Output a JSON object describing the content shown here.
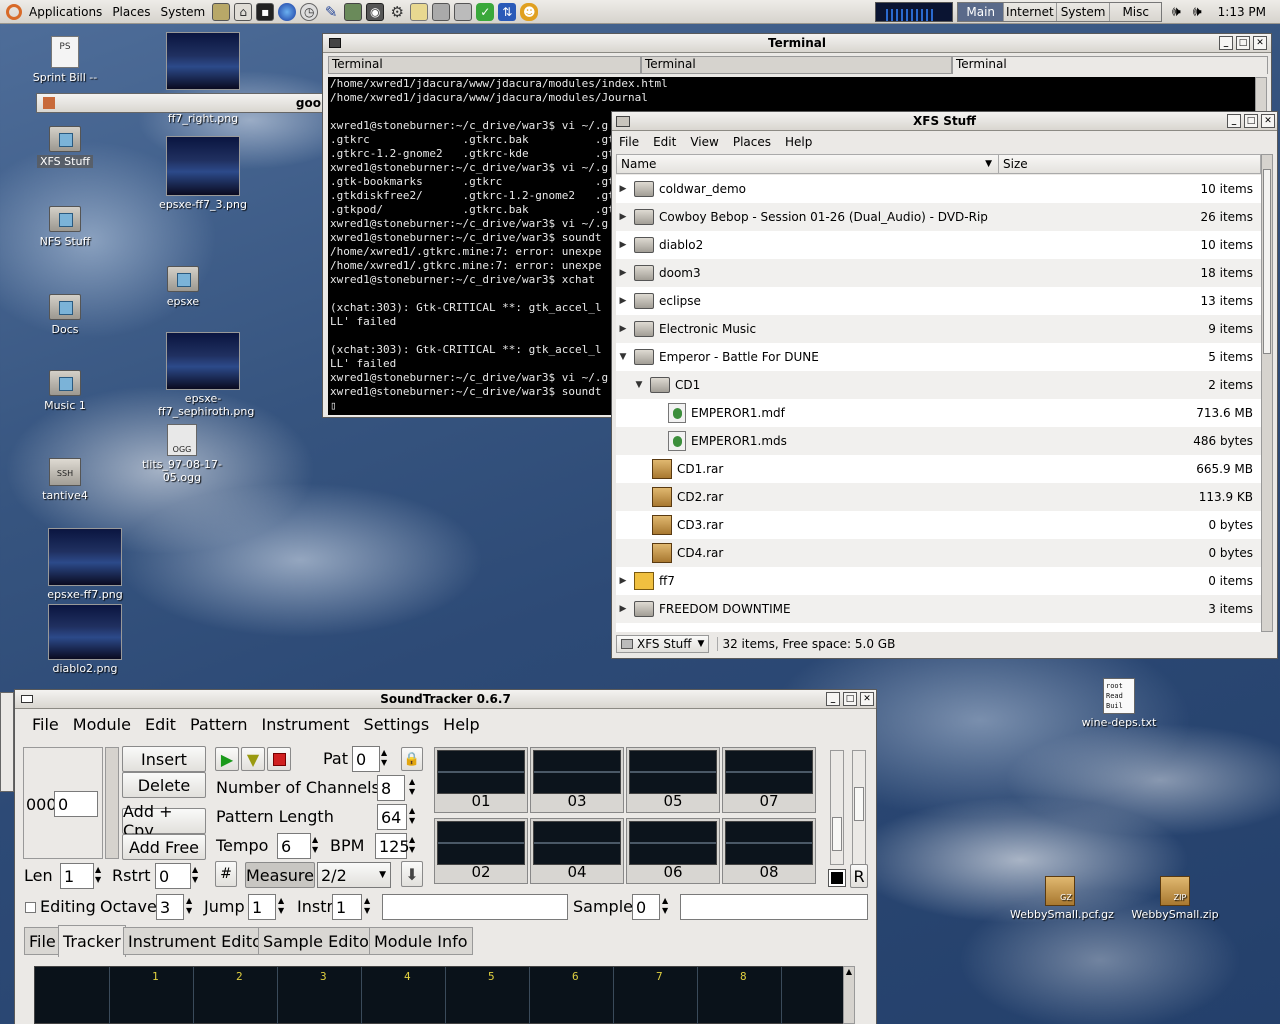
{
  "panel": {
    "menus": [
      "Applications",
      "Places",
      "System"
    ],
    "workspaces": [
      "Main",
      "Internet",
      "System",
      "Misc"
    ],
    "clock": "1:13 PM"
  },
  "desktop": {
    "icons": [
      "Sprint Bill -- Fucked up ?",
      "XFS Stuff",
      "NFS Stuff",
      "Docs",
      "Music 1",
      "tantive4",
      "ff7_right.png",
      "epsxe-ff7_3.png",
      "epsxe",
      "epsxe-ff7_sephiroth.png",
      "tlits_97-08-17-05.ogg",
      "epsxe-ff7.png",
      "diablo2.png",
      "wine-deps.txt",
      "WebbySmall.pcf.gz",
      "WebbySmall.zip"
    ],
    "readme_text": "root\nRead\nBuil",
    "partial_window_title": "goo",
    "ps_badge": "PS",
    "ogg_badge": "OGG",
    "ssh_badge": "SSH",
    "gz_badge": "GZ",
    "zip_badge": "ZIP"
  },
  "terminal": {
    "title": "Terminal",
    "tabs": [
      "Terminal",
      "Terminal",
      "Terminal"
    ],
    "lines": "/home/xwred1/jdacura/www/jdacura/modules/index.html\n/home/xwred1/jdacura/www/jdacura/modules/Journal\n\nxwred1@stoneburner:~/c_drive/war3$ vi ~/.g\n.gtkrc              .gtkrc.bak          .gt\n.gtkrc-1.2-gnome2   .gtkrc-kde          .gt\nxwred1@stoneburner:~/c_drive/war3$ vi ~/.g\n.gtk-bookmarks      .gtkrc              .gt\n.gtkdiskfree2/      .gtkrc-1.2-gnome2   .gt\n.gtkpod/            .gtkrc.bak          .gt\nxwred1@stoneburner:~/c_drive/war3$ vi ~/.g\nxwred1@stoneburner:~/c_drive/war3$ soundt\n/home/xwred1/.gtkrc.mine:7: error: unexpe\n/home/xwred1/.gtkrc.mine:7: error: unexpe\nxwred1@stoneburner:~/c_drive/war3$ xchat\n\n(xchat:303): Gtk-CRITICAL **: gtk_accel_l\nLL' failed\n\n(xchat:303): Gtk-CRITICAL **: gtk_accel_l\nLL' failed\nxwred1@stoneburner:~/c_drive/war3$ vi ~/.g\nxwred1@stoneburner:~/c_drive/war3$ soundt\n▯"
  },
  "filemanager": {
    "title": "XFS Stuff",
    "menu": [
      "File",
      "Edit",
      "View",
      "Places",
      "Help"
    ],
    "columns": {
      "name": "Name",
      "size": "Size"
    },
    "rows": [
      {
        "name": "coldwar_demo",
        "size": "10 items"
      },
      {
        "name": "Cowboy Bebop - Session 01-26 (Dual_Audio) - DVD-Rip",
        "size": "26 items"
      },
      {
        "name": "diablo2",
        "size": "10 items"
      },
      {
        "name": "doom3",
        "size": "18 items"
      },
      {
        "name": "eclipse",
        "size": "13 items"
      },
      {
        "name": "Electronic Music",
        "size": "9 items"
      },
      {
        "name": "Emperor - Battle For DUNE",
        "size": "5 items"
      },
      {
        "name": "CD1",
        "size": "2 items"
      },
      {
        "name": "EMPEROR1.mdf",
        "size": "713.6 MB"
      },
      {
        "name": "EMPEROR1.mds",
        "size": "486 bytes"
      },
      {
        "name": "CD1.rar",
        "size": "665.9 MB"
      },
      {
        "name": "CD2.rar",
        "size": "113.9 KB"
      },
      {
        "name": "CD3.rar",
        "size": "0 bytes"
      },
      {
        "name": "CD4.rar",
        "size": "0 bytes"
      },
      {
        "name": "ff7",
        "size": "0 items"
      },
      {
        "name": "FREEDOM DOWNTIME",
        "size": "3 items"
      }
    ],
    "status": {
      "location": "XFS Stuff",
      "info": "32 items, Free space: 5.0 GB"
    }
  },
  "soundtracker": {
    "title": "SoundTracker 0.6.7",
    "menu": [
      "File",
      "Module",
      "Edit",
      "Pattern",
      "Instrument",
      "Settings",
      "Help"
    ],
    "buttons": {
      "insert": "Insert",
      "delete": "Delete",
      "add_cpy": "Add + Cpy",
      "add_free": "Add Free",
      "measure": "Measure",
      "sharp": "#",
      "r": "R"
    },
    "pos_value": "000",
    "pos_field": "0",
    "pat_label": "Pat",
    "pat_value": "0",
    "channels_label": "Number of Channels:",
    "channels_value": "8",
    "pattern_length_label": "Pattern Length",
    "pattern_length_value": "64",
    "tempo_label": "Tempo",
    "tempo_value": "6",
    "bpm_label": "BPM",
    "bpm_value": "125",
    "measure_value": "2/2",
    "len_label": "Len",
    "len_value": "1",
    "rstrt_label": "Rstrt",
    "rstrt_value": "0",
    "editing_label": "Editing",
    "octave_label": "Octave",
    "octave_value": "3",
    "jump_label": "Jump",
    "jump_value": "1",
    "instr_label": "Instr",
    "instr_value": "1",
    "sample_label": "Sample",
    "sample_value": "0",
    "scopes": [
      "01",
      "03",
      "05",
      "07",
      "02",
      "04",
      "06",
      "08"
    ],
    "tabs": [
      "File",
      "Tracker",
      "Instrument Editor",
      "Sample Editor",
      "Module Info"
    ],
    "active_tab": "Tracker",
    "track_headers": [
      "1",
      "2",
      "3",
      "4",
      "5",
      "6",
      "7",
      "8"
    ]
  }
}
